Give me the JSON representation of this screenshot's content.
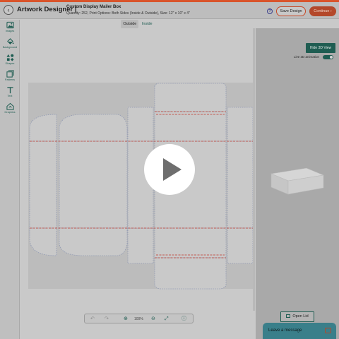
{
  "header": {
    "back_glyph": "‹",
    "app_title": "Artwork Designer |",
    "product_name": "Custom Display Mailer Box",
    "product_details": "Quantity: 252, Print Options: Both Sides (Inside & Outside), Size: 12\" x 10\" x 4\"",
    "help_glyph": "?",
    "save_label": "Save Design",
    "continue_label": "Continue ›"
  },
  "tools": [
    {
      "label": "Images",
      "icon": "image-icon"
    },
    {
      "label": "Background",
      "icon": "paint-bucket-icon"
    },
    {
      "label": "Shapes",
      "icon": "shapes-icon"
    },
    {
      "label": "Patterns",
      "icon": "pattern-icon"
    },
    {
      "label": "Text",
      "icon": "text-icon"
    },
    {
      "label": "Graphics",
      "icon": "graphics-icon"
    }
  ],
  "view_tabs": [
    {
      "label": "Outside",
      "active": true
    },
    {
      "label": "Inside",
      "active": false
    }
  ],
  "panel3d": {
    "hide_label": "Hide 3D View",
    "live_label": "Live 3D animation",
    "live_on": true,
    "open_lid_label": "Open Lid"
  },
  "zoom": {
    "undo_glyph": "↶",
    "redo_glyph": "↷",
    "zoom_in_glyph": "⊕",
    "level": "100%",
    "zoom_out_glyph": "⊖",
    "fit_glyph": "⤢",
    "info_glyph": "ⓘ"
  },
  "chat": {
    "label": "Leave a message"
  },
  "colors": {
    "accent": "#d9542b",
    "brand_green": "#1f5d52",
    "cut_line": "#7a8aa8",
    "fold_line": "#c0392b"
  }
}
